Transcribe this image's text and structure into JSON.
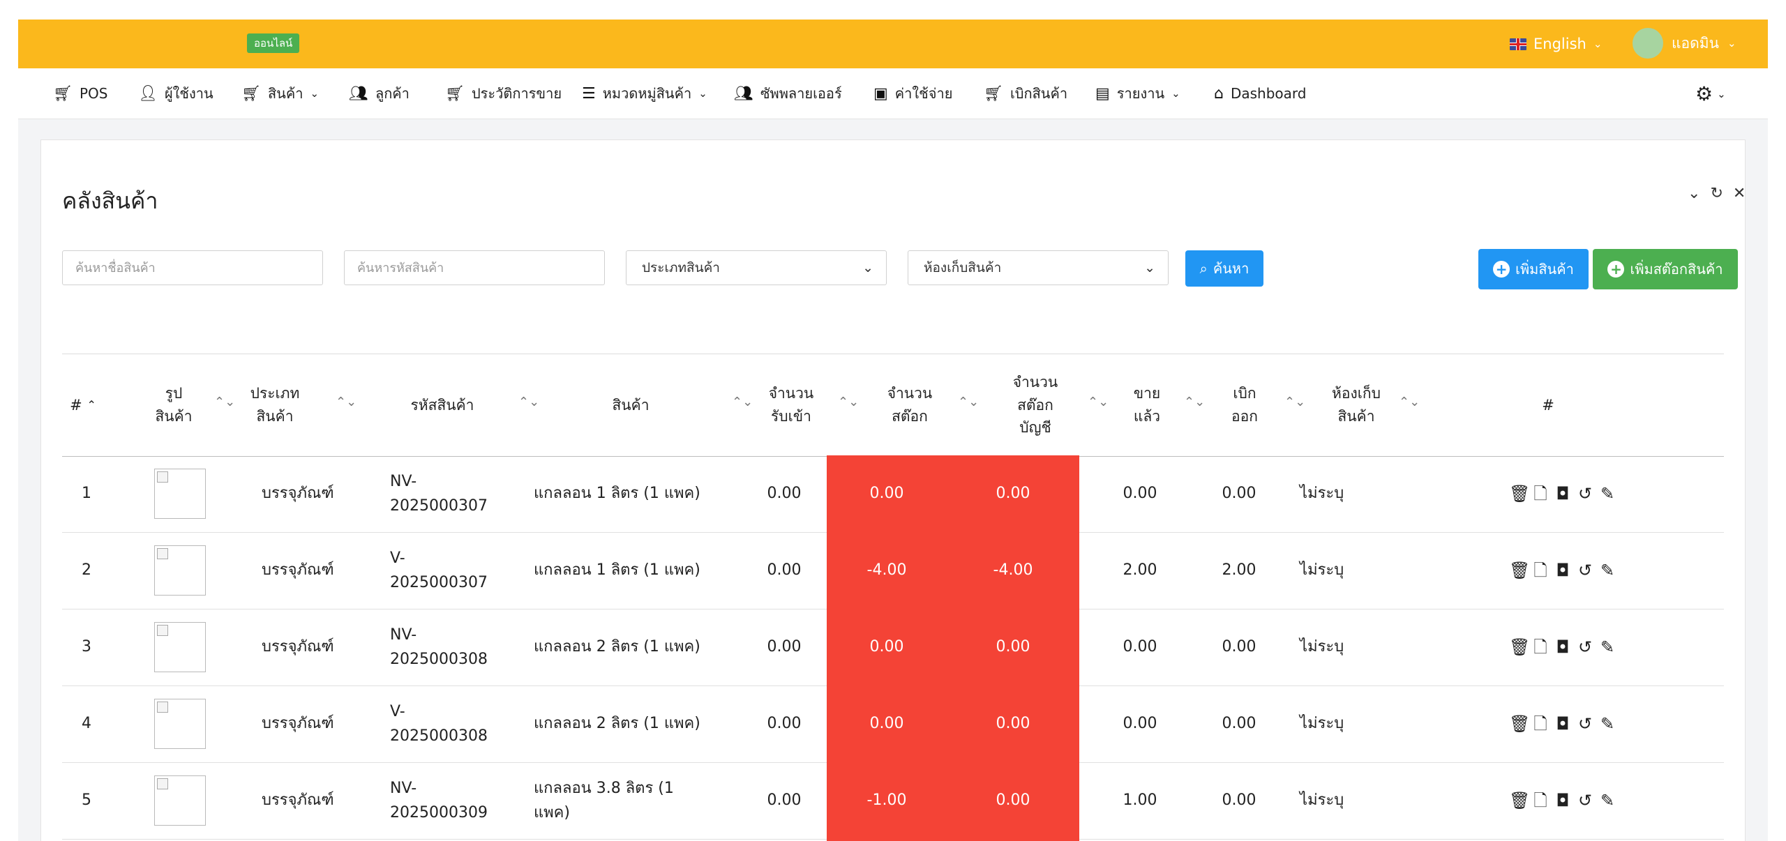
{
  "topbar": {
    "status_badge": "ออนไลน์",
    "language": "English",
    "user_name": "แอดมิน"
  },
  "nav": {
    "items": [
      {
        "label": "POS",
        "icon": "cart-icon",
        "dropdown": false
      },
      {
        "label": "ผู้ใช้งาน",
        "icon": "user-icon",
        "dropdown": false
      },
      {
        "label": "สินค้า",
        "icon": "cart-icon",
        "dropdown": true
      },
      {
        "label": "ลูกค้า",
        "icon": "users-icon",
        "dropdown": false
      },
      {
        "label": "ประวัติการขาย",
        "icon": "cart-icon",
        "dropdown": false
      },
      {
        "label": "หมวดหมู่สินค้า",
        "icon": "list-icon",
        "dropdown": true
      },
      {
        "label": "ซัพพลายเออร์",
        "icon": "users-icon",
        "dropdown": false
      },
      {
        "label": "ค่าใช้จ่าย",
        "icon": "wallet-icon",
        "dropdown": false
      },
      {
        "label": "เบิกสินค้า",
        "icon": "cart-icon",
        "dropdown": false
      },
      {
        "label": "รายงาน",
        "icon": "report-icon",
        "dropdown": true
      },
      {
        "label": "Dashboard",
        "icon": "home-icon",
        "dropdown": false
      }
    ]
  },
  "page": {
    "title": "คลังสินค้า",
    "filters": {
      "name_placeholder": "ค้นหาชื่อสินค้า",
      "code_placeholder": "ค้นหารหัสสินค้า",
      "category_selected": "ประเภทสินค้า",
      "warehouse_selected": "ห้องเก็บสินค้า",
      "search_label": "ค้นหา"
    },
    "buttons": {
      "add_product": "เพิ่มสินค้า",
      "add_stock": "เพิ่มสต๊อกสินค้า"
    }
  },
  "table": {
    "headers": {
      "index": "#",
      "image": "รูป\nสินค้า",
      "type": "ประเภท\nสินค้า",
      "code": "รหัสสินค้า",
      "product": "สินค้า",
      "received": "จำนวน\nรับเข้า",
      "stock": "จำนวน\nสต๊อก",
      "book_stock": "จำนวน\nสต๊อก\nบัญชี",
      "sold": "ขาย\nแล้ว",
      "withdrawn": "เบิก\nออก",
      "warehouse": "ห้องเก็บ\nสินค้า",
      "actions": "#"
    },
    "rows": [
      {
        "index": "1",
        "type": "บรรจุภัณฑ์",
        "code_prefix": "NV-",
        "code_number": "2025000307",
        "product": "แกลลอน 1 ลิตร (1 แพค)",
        "received": "0.00",
        "stock": "0.00",
        "book_stock": "0.00",
        "sold": "0.00",
        "withdrawn": "0.00",
        "warehouse": "ไม่ระบุ"
      },
      {
        "index": "2",
        "type": "บรรจุภัณฑ์",
        "code_prefix": "V-",
        "code_number": "2025000307",
        "product": "แกลลอน 1 ลิตร (1 แพค)",
        "received": "0.00",
        "stock": "-4.00",
        "book_stock": "-4.00",
        "sold": "2.00",
        "withdrawn": "2.00",
        "warehouse": "ไม่ระบุ"
      },
      {
        "index": "3",
        "type": "บรรจุภัณฑ์",
        "code_prefix": "NV-",
        "code_number": "2025000308",
        "product": "แกลลอน 2 ลิตร (1 แพค)",
        "received": "0.00",
        "stock": "0.00",
        "book_stock": "0.00",
        "sold": "0.00",
        "withdrawn": "0.00",
        "warehouse": "ไม่ระบุ"
      },
      {
        "index": "4",
        "type": "บรรจุภัณฑ์",
        "code_prefix": "V-",
        "code_number": "2025000308",
        "product": "แกลลอน 2 ลิตร (1 แพค)",
        "received": "0.00",
        "stock": "0.00",
        "book_stock": "0.00",
        "sold": "0.00",
        "withdrawn": "0.00",
        "warehouse": "ไม่ระบุ"
      },
      {
        "index": "5",
        "type": "บรรจุภัณฑ์",
        "code_prefix": "NV-",
        "code_number": "2025000309",
        "product": "แกลลอน 3.8 ลิตร (1 แพค)",
        "received": "0.00",
        "stock": "-1.00",
        "book_stock": "0.00",
        "sold": "1.00",
        "withdrawn": "0.00",
        "warehouse": "ไม่ระบุ"
      }
    ],
    "row_actions": [
      "trash-icon",
      "document-icon",
      "camera-icon",
      "history-icon",
      "edit-icon"
    ]
  },
  "colors": {
    "topbar": "#fbb81c",
    "primary": "#2196f3",
    "success": "#4caf50",
    "danger": "#f44336"
  }
}
